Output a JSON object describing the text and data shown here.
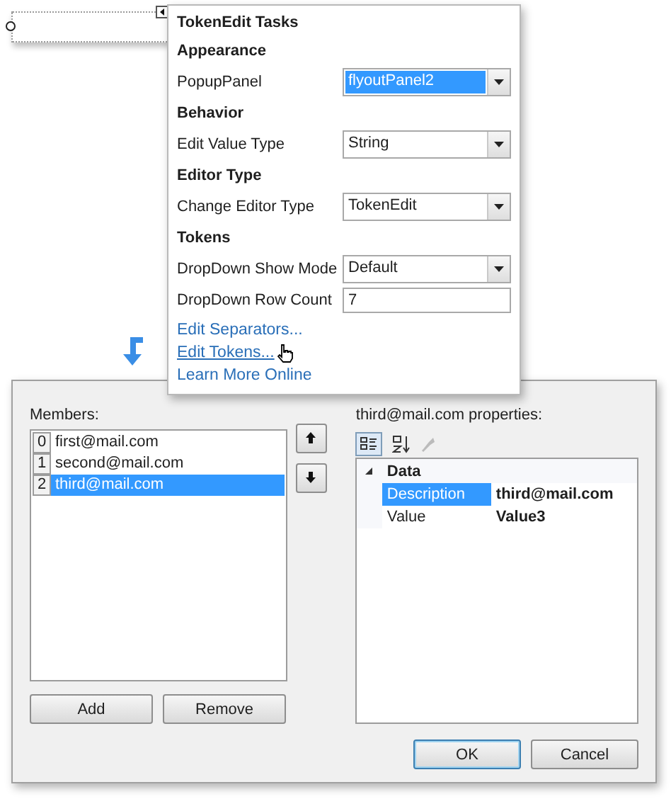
{
  "popup": {
    "title": "TokenEdit Tasks",
    "sections": [
      {
        "heading": "Appearance",
        "rows": [
          {
            "label": "PopupPanel",
            "kind": "dropdown",
            "value": "flyoutPanel2",
            "highlighted": true
          }
        ]
      },
      {
        "heading": "Behavior",
        "rows": [
          {
            "label": "Edit Value Type",
            "kind": "dropdown",
            "value": "String",
            "highlighted": false
          }
        ]
      },
      {
        "heading": "Editor Type",
        "rows": [
          {
            "label": "Change Editor Type",
            "kind": "dropdown",
            "value": "TokenEdit",
            "highlighted": false
          }
        ]
      },
      {
        "heading": "Tokens",
        "rows": [
          {
            "label": "DropDown Show Mode",
            "kind": "dropdown",
            "value": "Default",
            "highlighted": false
          },
          {
            "label": "DropDown Row Count",
            "kind": "text",
            "value": "7"
          }
        ]
      }
    ],
    "links": [
      {
        "label": "Edit Separators...",
        "hovered": false
      },
      {
        "label": "Edit Tokens...",
        "hovered": true
      },
      {
        "label": "Learn More Online",
        "hovered": false
      }
    ]
  },
  "dialog": {
    "members_label": "Members:",
    "members": [
      {
        "index": "0",
        "text": "first@mail.com",
        "selected": false
      },
      {
        "index": "1",
        "text": "second@mail.com",
        "selected": false
      },
      {
        "index": "2",
        "text": "third@mail.com",
        "selected": true
      }
    ],
    "properties_label": "third@mail.com properties:",
    "category": {
      "name": "Data",
      "expanded": true
    },
    "properties": [
      {
        "name": "Description",
        "value": "third@mail.com",
        "selected": true
      },
      {
        "name": "Value",
        "value": "Value3",
        "selected": false
      }
    ],
    "list_buttons": [
      "Add",
      "Remove"
    ],
    "buttons": [
      {
        "label": "OK",
        "default": true
      },
      {
        "label": "Cancel",
        "default": false
      }
    ]
  }
}
